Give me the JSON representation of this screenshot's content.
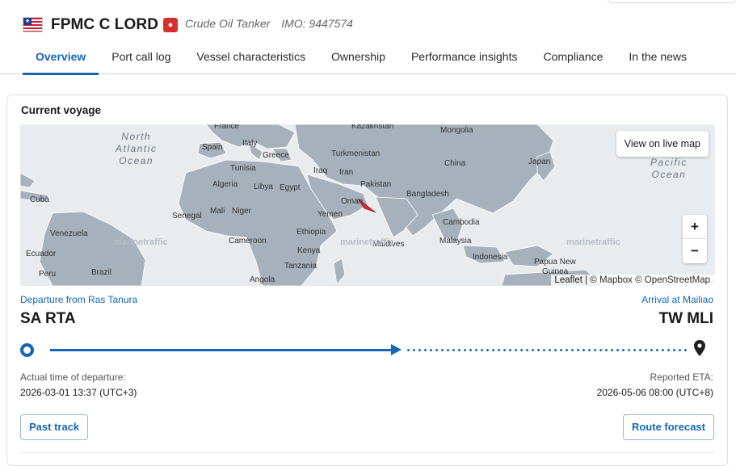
{
  "header": {
    "vessel_name": "FPMC C LORD",
    "vessel_type": "Crude Oil Tanker",
    "imo": "IMO: 9447574",
    "flag_icon": "liberia-flag-icon",
    "type_icon": "tanker-droplet-icon"
  },
  "tabs": [
    {
      "label": "Overview",
      "active": true
    },
    {
      "label": "Port call log",
      "active": false
    },
    {
      "label": "Vessel characteristics",
      "active": false
    },
    {
      "label": "Ownership",
      "active": false
    },
    {
      "label": "Performance insights",
      "active": false
    },
    {
      "label": "Compliance",
      "active": false
    },
    {
      "label": "In the news",
      "active": false
    }
  ],
  "voyage": {
    "title": "Current voyage",
    "map": {
      "live_map_button": "View on live map",
      "zoom_in": "+",
      "zoom_out": "−",
      "attribution": {
        "leaflet": "Leaflet",
        "separator": " | ",
        "mapbox": "© Mapbox",
        "osm": "© OpenStreetMap"
      },
      "watermark": "marinetraffic",
      "ocean_labels": {
        "north_atlantic": [
          "North",
          "Atlantic",
          "Ocean"
        ],
        "pacific": [
          "Pacific",
          "Ocean"
        ]
      },
      "place_labels": {
        "france": "France",
        "kazakhstan": "Kazakhstan",
        "mongolia": "Mongolia",
        "spain": "Spain",
        "italy": "Italy",
        "greece": "Greece",
        "turkmenistan": "Turkmenistan",
        "china": "China",
        "japan": "Japan",
        "tunisia": "Tunisia",
        "iraq": "Iraq",
        "iran": "Iran",
        "algeria": "Algeria",
        "libya": "Libya",
        "egypt": "Egypt",
        "pakistan": "Pakistan",
        "cuba": "Cuba",
        "bangladesh": "Bangladesh",
        "oman": "Oman",
        "senegal": "Senegal",
        "mali": "Mali",
        "niger": "Niger",
        "yemen": "Yemen",
        "cambodia": "Cambodia",
        "venezuela": "Venezuela",
        "cameroon": "Cameroon",
        "ethiopia": "Ethiopia",
        "maldives": "Maldives",
        "malaysia": "Malaysia",
        "ecuador": "Ecuador",
        "kenya": "Kenya",
        "indonesia": "Indonesia",
        "papua_new_guinea": "Papua New",
        "guinea": "Guinea",
        "peru": "Peru",
        "brazil": "Brazil",
        "tanzania": "Tanzania",
        "angola": "Angola"
      },
      "vessel_marker_icon": "vessel-position-arrow-icon"
    },
    "departure": {
      "label": "Departure from Ras Tanura",
      "code": "SA RTA",
      "time_label": "Actual time of departure:",
      "time_value": "2026-03-01 13:37 (UTC+3)"
    },
    "arrival": {
      "label": "Arrival at Mailiao",
      "code": "TW MLI",
      "time_label": "Reported ETA:",
      "time_value": "2026-05-06 08:00 (UTC+8)"
    },
    "progress_fraction": 0.55,
    "buttons": {
      "past_track": "Past track",
      "route_forecast": "Route forecast"
    }
  },
  "colors": {
    "accent": "#1566b6",
    "map_water": "#e9ecef",
    "map_land": "#a7b1bb",
    "vessel_marker": "#e3262b"
  }
}
